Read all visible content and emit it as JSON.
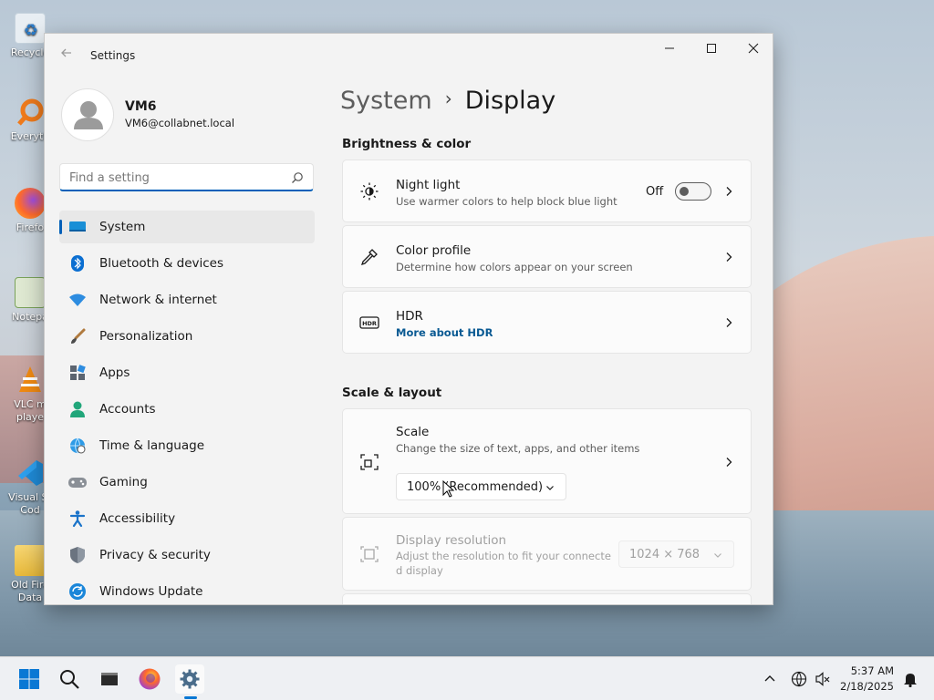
{
  "desktop": {
    "icons": [
      {
        "label": "Recycle"
      },
      {
        "label": "Everyth"
      },
      {
        "label": "Firefo"
      },
      {
        "label": "Notepa"
      },
      {
        "label": "VLC m"
      },
      {
        "label": "playe"
      },
      {
        "label": "Visual St"
      },
      {
        "label": "Cod"
      },
      {
        "label": "Old Fire"
      },
      {
        "label": "Data"
      }
    ]
  },
  "window": {
    "title": "Settings",
    "controls": {
      "minimize": "minimize",
      "maximize": "maximize",
      "close": "close"
    }
  },
  "profile": {
    "name": "VM6",
    "email": "VM6@collabnet.local"
  },
  "search": {
    "placeholder": "Find a setting",
    "value": ""
  },
  "sidebar": {
    "items": [
      {
        "label": "System",
        "icon": "system-icon",
        "selected": true
      },
      {
        "label": "Bluetooth & devices",
        "icon": "bluetooth-icon"
      },
      {
        "label": "Network & internet",
        "icon": "network-icon"
      },
      {
        "label": "Personalization",
        "icon": "brush-icon"
      },
      {
        "label": "Apps",
        "icon": "apps-icon"
      },
      {
        "label": "Accounts",
        "icon": "accounts-icon"
      },
      {
        "label": "Time & language",
        "icon": "globe-clock-icon"
      },
      {
        "label": "Gaming",
        "icon": "gamepad-icon"
      },
      {
        "label": "Accessibility",
        "icon": "accessibility-icon"
      },
      {
        "label": "Privacy & security",
        "icon": "shield-icon"
      },
      {
        "label": "Windows Update",
        "icon": "update-icon"
      }
    ]
  },
  "breadcrumb": {
    "parent": "System",
    "separator": "›",
    "current": "Display"
  },
  "sections": {
    "brightness": {
      "heading": "Brightness & color",
      "night_light": {
        "title": "Night light",
        "subtitle": "Use warmer colors to help block blue light",
        "state": "Off"
      },
      "color_profile": {
        "title": "Color profile",
        "subtitle": "Determine how colors appear on your screen"
      },
      "hdr": {
        "title": "HDR",
        "link": "More about HDR"
      }
    },
    "scale_layout": {
      "heading": "Scale & layout",
      "scale": {
        "title": "Scale",
        "subtitle": "Change the size of text, apps, and other items",
        "value": "100% (Recommended)"
      },
      "resolution": {
        "title": "Display resolution",
        "subtitle_line1": "Adjust the resolution to fit your connecte",
        "subtitle_line2": "d display",
        "value": "1024 × 768"
      }
    }
  },
  "taskbar": {
    "apps": [
      "start-icon",
      "search-icon",
      "terminal-icon",
      "firefox-icon",
      "settings-icon"
    ],
    "clock": {
      "time": "5:37 AM",
      "date": "2/18/2025"
    }
  },
  "colors": {
    "accent": "#005fb8",
    "window_bg": "#f3f3f3",
    "card_bg": "#fbfbfb"
  }
}
